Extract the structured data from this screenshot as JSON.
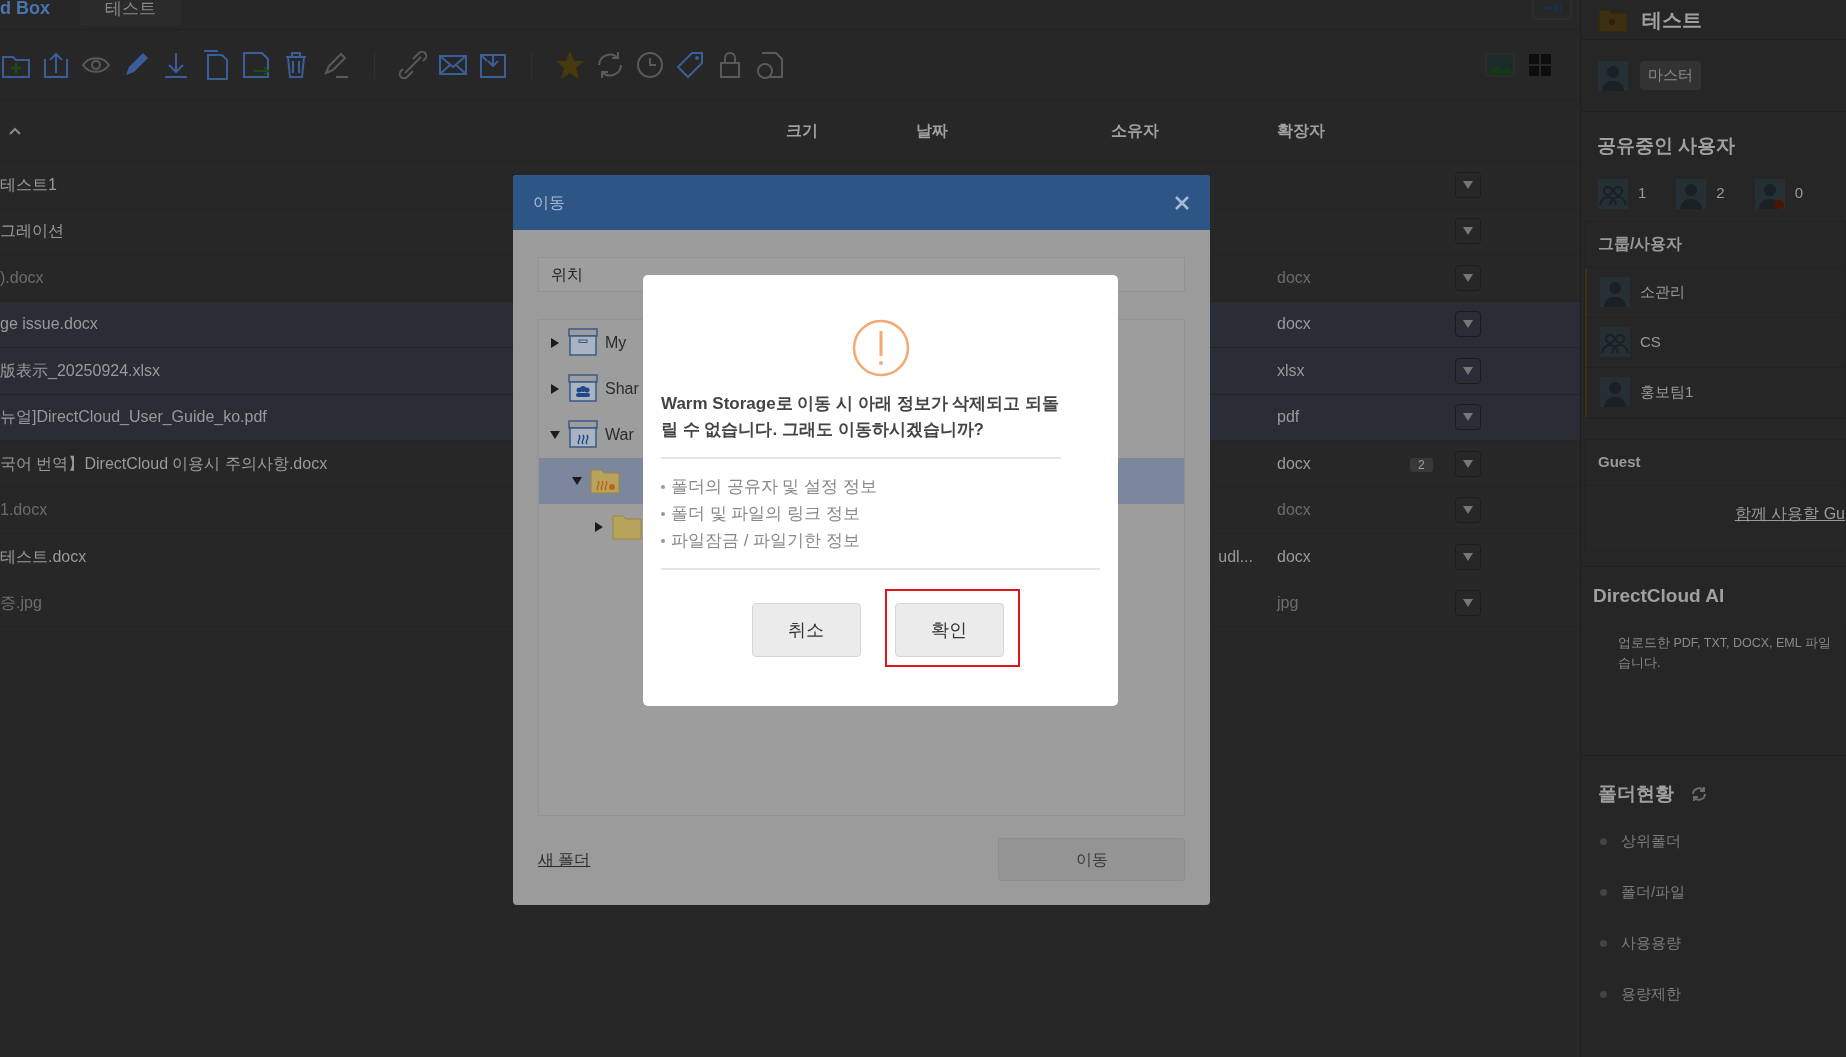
{
  "app": {
    "brand": "d Box",
    "tab": "테스트"
  },
  "file_table": {
    "columns": [
      "크기",
      "날짜",
      "소유자",
      "확장자"
    ],
    "rows": [
      {
        "name": "테스트1",
        "owner": "",
        "extension": "",
        "selected": false,
        "greyed": false
      },
      {
        "name": "그레이션",
        "owner": "",
        "extension": "",
        "selected": false,
        "greyed": false
      },
      {
        "name": ").docx",
        "owner": "",
        "extension": "docx",
        "selected": false,
        "greyed": true
      },
      {
        "name": "ge issue.docx",
        "owner": "",
        "extension": "docx",
        "selected": true,
        "greyed": false
      },
      {
        "name": "版表示_20250924.xlsx",
        "owner": "",
        "extension": "xlsx",
        "selected": true,
        "greyed": false
      },
      {
        "name": "뉴얼]DirectCloud_User_Guide_ko.pdf",
        "owner": "",
        "extension": "pdf",
        "selected": true,
        "greyed": false
      },
      {
        "name": "국어 번역】DirectCloud 이용시 주의사항.docx",
        "owner": "",
        "extension": "docx",
        "selected": false,
        "greyed": false,
        "comments": "2"
      },
      {
        "name": "1.docx",
        "owner": "",
        "extension": "docx",
        "selected": false,
        "greyed": true
      },
      {
        "name": "테스트.docx",
        "owner": "udl...",
        "extension": "docx",
        "selected": false,
        "greyed": false
      },
      {
        "name": "증.jpg",
        "owner": "",
        "extension": "jpg",
        "selected": false,
        "greyed": true
      }
    ]
  },
  "move_dialog": {
    "title": "이동",
    "location_label": "위치",
    "tree": [
      {
        "label": "My",
        "kind": "box",
        "expanded": false,
        "selected": false
      },
      {
        "label": "Shar",
        "kind": "shared",
        "expanded": false,
        "selected": false
      },
      {
        "label": "War",
        "kind": "warm",
        "expanded": true,
        "selected": false,
        "children": [
          {
            "kind": "warm-folder",
            "expanded": true,
            "selected": true,
            "children": [
              {
                "kind": "folder",
                "expanded": false,
                "selected": false
              }
            ]
          }
        ]
      }
    ],
    "new_folder": "새 폴더",
    "move_button": "이동"
  },
  "confirm_dialog": {
    "message": "Warm Storage로 이동 시 아래 정보가 삭제되고 되돌릴 수 없습니다. 그래도 이동하시겠습니까?",
    "items": [
      "폴더의 공유자 및 설정 정보",
      "폴더 및 파일의 링크 정보",
      "파일잠금 / 파일기한 정보"
    ],
    "buttons": [
      {
        "label": "취소",
        "highlighted": false
      },
      {
        "label": "확인",
        "highlighted": true
      }
    ]
  },
  "sidebar": {
    "folder_name": "테스트",
    "role_badge": "마스터",
    "shared_users": {
      "title": "공유중인 사용자",
      "counts": [
        {
          "kind": "group",
          "count": "1"
        },
        {
          "kind": "user",
          "count": "2"
        },
        {
          "kind": "pending",
          "count": "0"
        }
      ],
      "list_title": "그룹/사용자",
      "members": [
        {
          "kind": "user",
          "name": "소관리"
        },
        {
          "kind": "group",
          "name": "CS"
        },
        {
          "kind": "user",
          "name": "홍보팀1"
        }
      ]
    },
    "guest": {
      "title": "Guest",
      "link": "함께 사용할 Gu"
    },
    "ai": {
      "title": "DirectCloud AI",
      "description": [
        "업로드한 PDF, TXT, DOCX, EML 파일",
        "습니다."
      ]
    },
    "folder_status": {
      "title": "폴더현황",
      "items": [
        "상위폴더",
        "폴더/파일",
        "사용용량",
        "용량제한"
      ]
    }
  }
}
